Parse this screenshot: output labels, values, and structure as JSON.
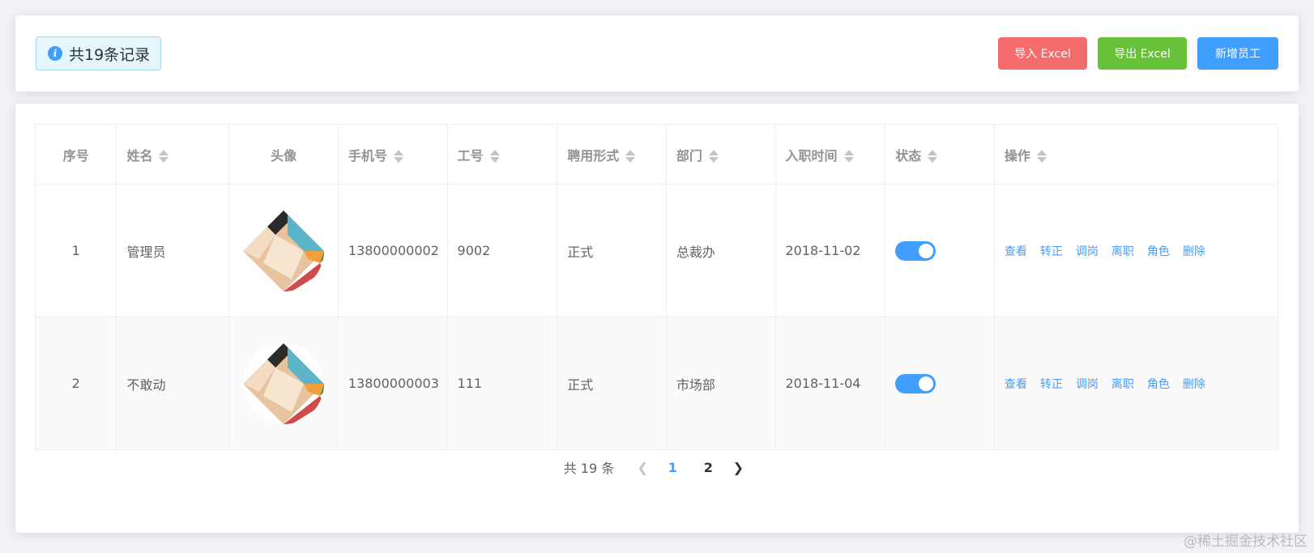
{
  "header": {
    "record_count": "共19条记录",
    "import_label": "导入 Excel",
    "export_label": "导出 Excel",
    "add_label": "新增员工"
  },
  "table": {
    "columns": [
      "序号",
      "姓名",
      "头像",
      "手机号",
      "工号",
      "聘用形式",
      "部门",
      "入职时间",
      "状态",
      "操作"
    ],
    "rows": [
      {
        "index": "1",
        "name": "管理员",
        "phone": "13800000002",
        "work_no": "9002",
        "employment": "正式",
        "department": "总裁办",
        "hire_date": "2018-11-02",
        "status": true
      },
      {
        "index": "2",
        "name": "不敢动",
        "phone": "13800000003",
        "work_no": "111",
        "employment": "正式",
        "department": "市场部",
        "hire_date": "2018-11-04",
        "status": true
      }
    ],
    "actions": [
      "查看",
      "转正",
      "调岗",
      "离职",
      "角色",
      "删除"
    ]
  },
  "pagination": {
    "total": "共 19 条",
    "pages": [
      "1",
      "2"
    ],
    "current": "1"
  },
  "watermark": "@稀土掘金技术社区",
  "colors": {
    "primary": "#409eff",
    "danger": "#f56c6c",
    "success": "#67c23a"
  }
}
